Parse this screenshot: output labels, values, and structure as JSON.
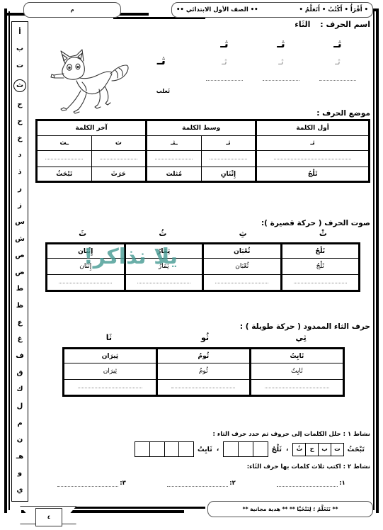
{
  "header": {
    "main_pill_left": "•• الصف الأول الابتدائي ••",
    "main_pill_right": "• أَقْرَأُ • أَكْتُبُ • أَتَعَلَّمُ •",
    "code_pill": "م"
  },
  "footer": {
    "note": "** نَتَعَلَّمُ ؛ لِنَتْخَيَّا ** ** هدية مجانية **",
    "page_number": "٤"
  },
  "alphabet_rail": {
    "current": "ث",
    "letters": [
      "أ",
      "ب",
      "ت",
      "ث",
      "ج",
      "ح",
      "خ",
      "د",
      "ذ",
      "ر",
      "ز",
      "س",
      "ش",
      "ص",
      "ض",
      "ط",
      "ظ",
      "ع",
      "غ",
      "ف",
      "ق",
      "ك",
      "ل",
      "م",
      "ن",
      "هـ",
      "و",
      "ي"
    ]
  },
  "letter_name": {
    "label": "اسم الحرف :",
    "value": "الثَاء"
  },
  "trace": {
    "solid_row": [
      "ثـ",
      "ثـ",
      "ثـ"
    ],
    "dotted_row": [
      "ثـ",
      "ثـ",
      "ثـ"
    ],
    "blank_row": [
      "",
      "",
      ""
    ]
  },
  "illustration": {
    "letter": "ثـ",
    "caption": "ثَعلب",
    "icon": "fox-icon"
  },
  "position_section": {
    "title": "موضع الحرف :",
    "headers": [
      "أول الكلمة",
      "وسط الكلمة",
      "آخر الكلمة"
    ],
    "forms": [
      "ثـ",
      "ثـ",
      "ـثـ",
      "ث",
      "ـث"
    ],
    "words": [
      "ثَلْجُ",
      "إِثْنَانِ",
      "مُثلث",
      "حَرَثَ",
      "تَبْحَثُ"
    ]
  },
  "short_vowel_section": {
    "title": "صوت الحرف ( حركة قصيرة ):",
    "vowels": [
      "ثَ",
      "ثُ",
      "ثِ",
      "ثْ"
    ],
    "words": [
      "ثَلْجُ",
      "ثُعْبَان",
      "ثِمَارُ",
      "إِثْنَان"
    ],
    "ghost_words": [
      "ثَلْجُ",
      "ثُعْبَان",
      "ثِمَارُ",
      "إِثْنَان"
    ]
  },
  "long_vowel_section": {
    "title": "حرف الثاء الممدود ( حركة طويلة ) :",
    "vowels": [
      "ثَا",
      "ثُو",
      "ثِي"
    ],
    "words": [
      "ثَابِتُ",
      "ثُومُ",
      "ثِيرَان"
    ],
    "ghost_words": [
      "ثَابِتُ",
      "ثُومُ",
      "ثِيرَان"
    ]
  },
  "activity1": {
    "title": "نشاط ١ : حلل الكلمات إلى حروف ثم حدد حرف الثاء :",
    "word1": "تَبْحَثُ",
    "word1_letters": [
      "ت",
      "ب",
      "ح",
      "ثُ"
    ],
    "word2": "ثَلْجُ",
    "word2_boxes": [
      "",
      "",
      ""
    ],
    "separator": "،",
    "word3": "ثَابِتُ",
    "word3_boxes": [
      "",
      "",
      "",
      ""
    ]
  },
  "activity2": {
    "title": "نشاط ٢ :  اكتب ثلاث كلمات بها حرف الثَاء:",
    "items": [
      "١:",
      "٢:",
      "٣:"
    ]
  },
  "watermark": {
    "text": "يلا نذاكر!",
    "color": "#4a9d96"
  }
}
